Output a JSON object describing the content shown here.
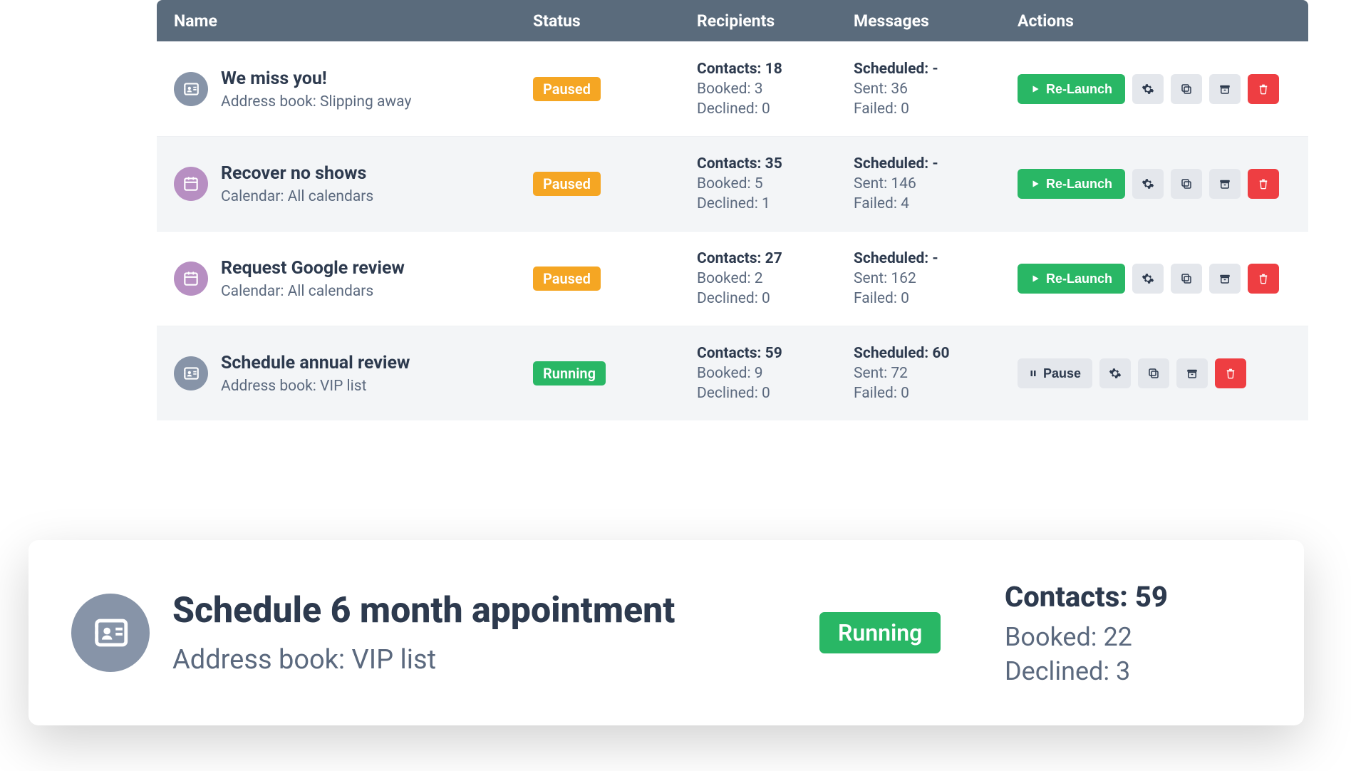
{
  "headers": {
    "name": "Name",
    "status": "Status",
    "recipients": "Recipients",
    "messages": "Messages",
    "actions": "Actions"
  },
  "labels": {
    "contacts": "Contacts",
    "booked": "Booked",
    "declined": "Declined",
    "scheduled": "Scheduled",
    "sent": "Sent",
    "failed": "Failed",
    "relaunch": "Re-Launch",
    "pause": "Pause"
  },
  "status_colors": {
    "Paused": "pill-paused",
    "Running": "pill-running"
  },
  "rows": [
    {
      "icon": "contact",
      "title": "We miss you!",
      "sub": "Address book: Slipping away",
      "status": "Paused",
      "recipients": {
        "contacts": 18,
        "booked": 3,
        "declined": 0
      },
      "messages": {
        "scheduled": "-",
        "sent": 36,
        "failed": 0
      },
      "primary": "relaunch"
    },
    {
      "icon": "calendar",
      "title": "Recover no shows",
      "sub": "Calendar: All calendars",
      "status": "Paused",
      "recipients": {
        "contacts": 35,
        "booked": 5,
        "declined": 1
      },
      "messages": {
        "scheduled": "-",
        "sent": 146,
        "failed": 4
      },
      "primary": "relaunch"
    },
    {
      "icon": "calendar",
      "title": "Request Google review",
      "sub": "Calendar: All calendars",
      "status": "Paused",
      "recipients": {
        "contacts": 27,
        "booked": 2,
        "declined": 0
      },
      "messages": {
        "scheduled": "-",
        "sent": 162,
        "failed": 0
      },
      "primary": "relaunch"
    },
    {
      "icon": "contact",
      "title": "Schedule annual review",
      "sub": "Address book: VIP list",
      "status": "Running",
      "recipients": {
        "contacts": 59,
        "booked": 9,
        "declined": 0
      },
      "messages": {
        "scheduled": 60,
        "sent": 72,
        "failed": 0
      },
      "primary": "pause"
    }
  ],
  "float": {
    "title": "Schedule 6 month appointment",
    "sub": "Address book: VIP list",
    "status": "Running",
    "recipients": {
      "contacts": 59,
      "booked": 22,
      "declined": 3
    }
  }
}
